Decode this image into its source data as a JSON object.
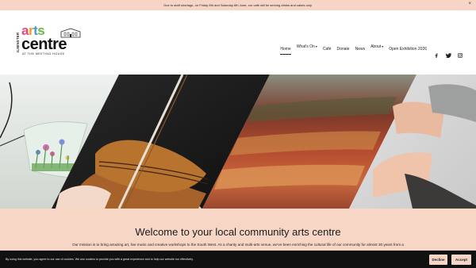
{
  "announcement": {
    "text": "Due to staff shortage, on Friday 5th and Saturday 6th June, our café will be serving drinks and cakes only.",
    "close": "×"
  },
  "logo": {
    "side_text": "ILMINSTER",
    "arts_letters": [
      "a",
      "r",
      "t",
      "s"
    ],
    "centre": "centre",
    "tagline": "AT THE MEETING HOUSE"
  },
  "nav": {
    "items": [
      {
        "label": "Home"
      },
      {
        "label": "What's On",
        "caret": "▾"
      },
      {
        "label": "Café"
      },
      {
        "label": "Donate"
      },
      {
        "label": "News"
      },
      {
        "label": "About",
        "caret": "▾"
      },
      {
        "label": "Open Exhibition 2026"
      }
    ],
    "social": [
      "facebook-icon",
      "twitter-icon",
      "instagram-icon"
    ]
  },
  "welcome": {
    "title": "Welcome to your local community arts centre",
    "body": "Our mission is to bring amazing art, live music and creative workshops to the South West. As a charity and multi-arts venue, we've been enriching the cultural life of our community for almost 30 years from a"
  },
  "cookie": {
    "text": "By using this website, you agree to our use of cookies. We use cookies to provide you with a great experience and to help our website run effectively.",
    "decline": "Decline",
    "accept": "Accept"
  },
  "colors": {
    "announcement_bg": "#f6d5c6",
    "welcome_bg": "#f8d6c6",
    "cookie_bg": "#111111"
  }
}
